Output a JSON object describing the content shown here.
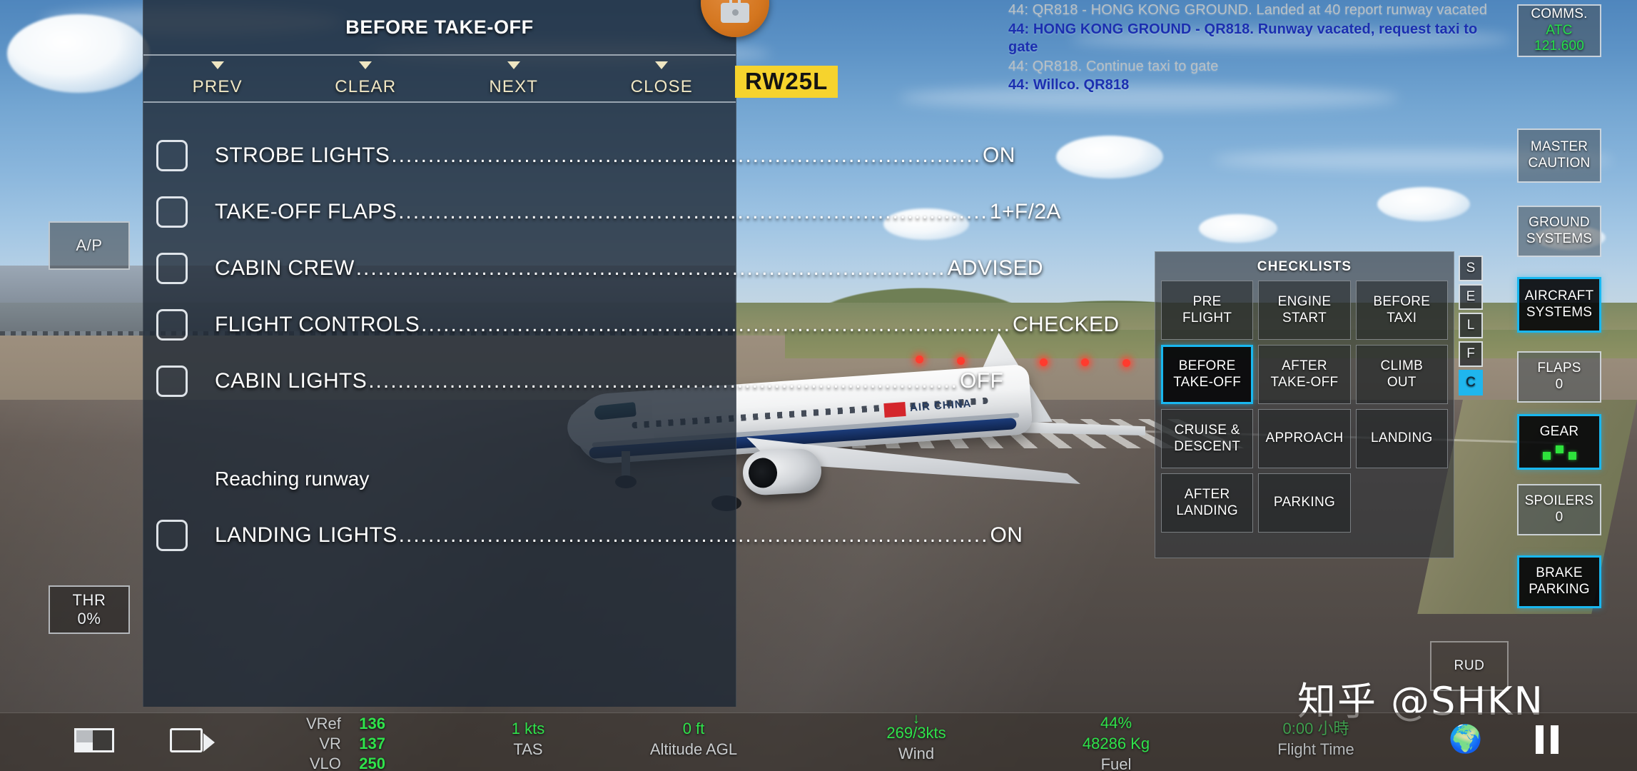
{
  "app": {
    "runway_tag": "RW25L",
    "watermark": "知乎 @SHKN"
  },
  "checklist_panel": {
    "title": "BEFORE TAKE-OFF",
    "nav": [
      {
        "label": "PREV"
      },
      {
        "label": "CLEAR"
      },
      {
        "label": "NEXT"
      },
      {
        "label": "CLOSE"
      }
    ],
    "items": [
      {
        "type": "check",
        "label": "STROBE LIGHTS",
        "value": "ON"
      },
      {
        "type": "check",
        "label": "TAKE-OFF FLAPS",
        "value": "1+F/2A"
      },
      {
        "type": "check",
        "label": "CABIN CREW",
        "value": "ADVISED"
      },
      {
        "type": "check",
        "label": "FLIGHT CONTROLS",
        "value": "CHECKED"
      },
      {
        "type": "check",
        "label": "CABIN LIGHTS",
        "value": "OFF"
      },
      {
        "type": "note",
        "label": "Reaching runway",
        "value": ""
      },
      {
        "type": "check",
        "label": "LANDING LIGHTS",
        "value": "ON"
      }
    ]
  },
  "atc_log": [
    {
      "dir": "out",
      "text": "44: QR818 - HONG KONG GROUND. Landed at 40 report runway vacated"
    },
    {
      "dir": "in",
      "text": "44: HONG KONG GROUND - QR818. Runway vacated, request taxi to gate"
    },
    {
      "dir": "out",
      "text": "44: QR818. Continue taxi to gate"
    },
    {
      "dir": "in",
      "text": "44: Willco. QR818"
    }
  ],
  "checklists_popup": {
    "title": "CHECKLISTS",
    "buttons": [
      {
        "label": "PRE\nFLIGHT",
        "active": false
      },
      {
        "label": "ENGINE\nSTART",
        "active": false
      },
      {
        "label": "BEFORE\nTAXI",
        "active": false
      },
      {
        "label": "BEFORE\nTAKE-OFF",
        "active": true
      },
      {
        "label": "AFTER\nTAKE-OFF",
        "active": false
      },
      {
        "label": "CLIMB\nOUT",
        "active": false
      },
      {
        "label": "CRUISE &\nDESCENT",
        "active": false
      },
      {
        "label": "APPROACH",
        "active": false
      },
      {
        "label": "LANDING",
        "active": false
      },
      {
        "label": "AFTER\nLANDING",
        "active": false
      },
      {
        "label": "PARKING",
        "active": false
      }
    ]
  },
  "selfc_tabs": [
    {
      "label": "S",
      "active": false
    },
    {
      "label": "E",
      "active": false
    },
    {
      "label": "L",
      "active": false
    },
    {
      "label": "F",
      "active": false
    },
    {
      "label": "C",
      "active": true
    }
  ],
  "left_controls": {
    "autopilot": {
      "label": "A/P"
    },
    "throttle": {
      "label": "THR",
      "value": "0%"
    },
    "rudder": {
      "label": "RUD"
    }
  },
  "sidebar": {
    "comms": {
      "label": "COMMS.",
      "mode": "ATC",
      "frequency": "121.600"
    },
    "master_caution": {
      "label": "MASTER\nCAUTION"
    },
    "ground_systems": {
      "label": "GROUND\nSYSTEMS"
    },
    "aircraft_systems": {
      "label": "AIRCRAFT\nSYSTEMS",
      "active": true
    },
    "flaps": {
      "label": "FLAPS",
      "value": "0"
    },
    "gear": {
      "label": "GEAR",
      "active": true
    },
    "spoilers": {
      "label": "SPOILERS",
      "value": "0"
    },
    "brake_parking": {
      "label": "BRAKE\nPARKING",
      "active": true
    }
  },
  "status_bar": {
    "vspeeds": {
      "vref_label": "VRef",
      "vref_value": "136",
      "vr_label": "VR",
      "vr_value": "137",
      "vlo_label": "VLO",
      "vlo_value": "250"
    },
    "tas": {
      "value": "1 kts",
      "label": "TAS"
    },
    "altitude": {
      "value": "0 ft",
      "label": "Altitude AGL"
    },
    "wind": {
      "value": "269/3kts",
      "label": "Wind",
      "arrow": "↓"
    },
    "fuel": {
      "percent": "44%",
      "value": "48286 Kg",
      "label": "Fuel"
    },
    "flight_time": {
      "value": "0:00 小時",
      "label": "Flight Time"
    }
  },
  "icons": {
    "briefcase": "briefcase-icon",
    "layout": "layout-icon",
    "camera": "camera-icon",
    "globe": "🌍",
    "pause": "pause-icon"
  }
}
